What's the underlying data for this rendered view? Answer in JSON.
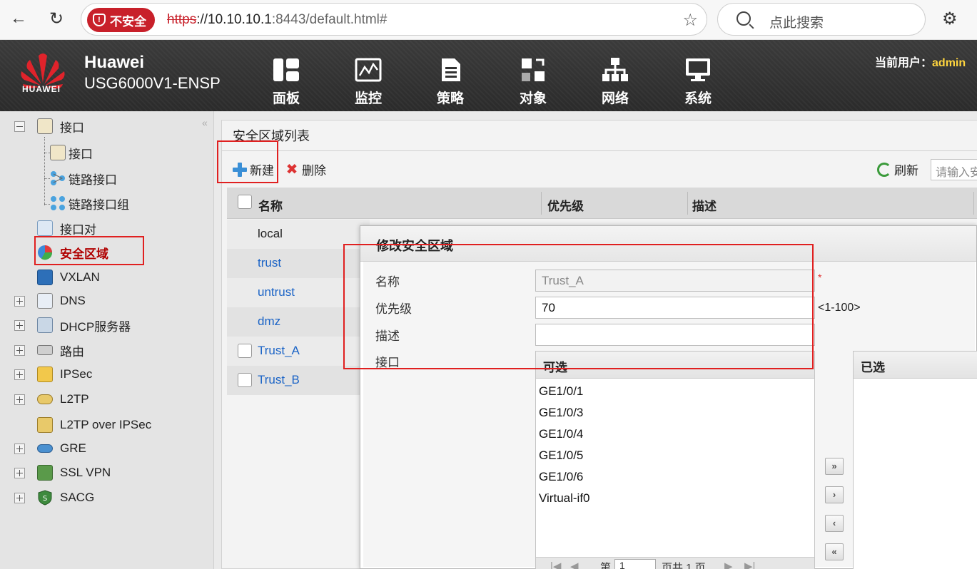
{
  "browser": {
    "security_label": "不安全",
    "url_scheme": "https",
    "url_host": "://10.10.10.1",
    "url_rest": ":8443/default.html#",
    "search_placeholder": "点此搜索"
  },
  "header": {
    "logo_word": "HUAWEI",
    "brand": "Huawei",
    "model": "USG6000V1-ENSP",
    "menu": [
      {
        "label": "面板",
        "icon": "dashboard-icon"
      },
      {
        "label": "监控",
        "icon": "monitor-icon"
      },
      {
        "label": "策略",
        "icon": "policy-icon"
      },
      {
        "label": "对象",
        "icon": "object-icon"
      },
      {
        "label": "网络",
        "icon": "network-icon"
      },
      {
        "label": "系统",
        "icon": "system-icon"
      }
    ],
    "user_prefix": "当前用户：",
    "user_name": "admin"
  },
  "sidebar": {
    "items": [
      {
        "label": "接口"
      },
      {
        "label": "接口"
      },
      {
        "label": "链路接口"
      },
      {
        "label": "链路接口组"
      },
      {
        "label": "接口对"
      },
      {
        "label": "安全区域"
      },
      {
        "label": "VXLAN"
      },
      {
        "label": "DNS"
      },
      {
        "label": "DHCP服务器"
      },
      {
        "label": "路由"
      },
      {
        "label": "IPSec"
      },
      {
        "label": "L2TP"
      },
      {
        "label": "L2TP over IPSec"
      },
      {
        "label": "GRE"
      },
      {
        "label": "SSL VPN"
      },
      {
        "label": "SACG"
      }
    ]
  },
  "main": {
    "panel_title": "安全区域列表",
    "toolbar": {
      "new_label": "新建",
      "delete_label": "删除",
      "refresh_label": "刷新",
      "search_placeholder": "请输入安"
    },
    "columns": [
      "名称",
      "优先级",
      "描述"
    ],
    "rows": [
      {
        "name": "local"
      },
      {
        "name": "trust"
      },
      {
        "name": "untrust"
      },
      {
        "name": "dmz"
      },
      {
        "name": "Trust_A"
      },
      {
        "name": "Trust_B"
      }
    ]
  },
  "dialog": {
    "title": "修改安全区域",
    "name_label": "名称",
    "name_value": "Trust_A",
    "priority_label": "优先级",
    "priority_value": "70",
    "priority_hint": "<1-100>",
    "desc_label": "描述",
    "desc_value": "",
    "interface_label": "接口",
    "available_header": "可选",
    "selected_header": "已选",
    "available_items": [
      "GE1/0/1",
      "GE1/0/3",
      "GE1/0/4",
      "GE1/0/5",
      "GE1/0/6",
      "Virtual-if0"
    ],
    "pager_page_prefix": "第",
    "pager_page_value": "1",
    "pager_total": "页共 1 页"
  },
  "colors": {
    "accent_red": "#e02020",
    "link_blue": "#1a63c6",
    "user_yellow": "#ffd53e"
  }
}
